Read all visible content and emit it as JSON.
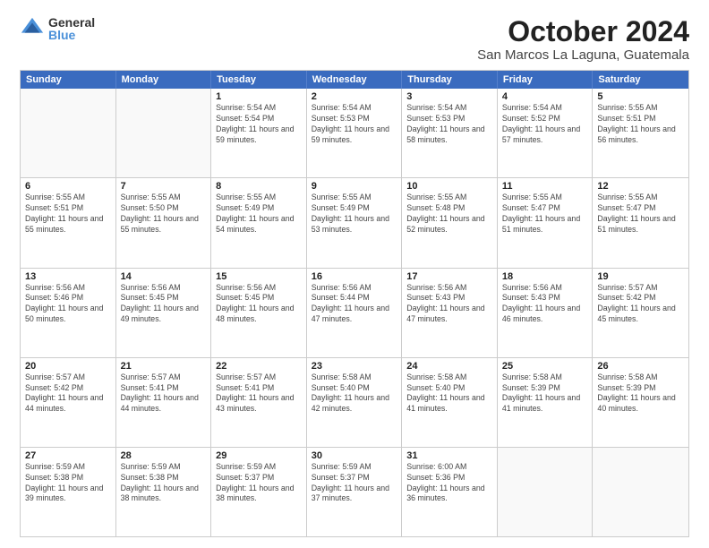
{
  "logo": {
    "general": "General",
    "blue": "Blue"
  },
  "title": "October 2024",
  "location": "San Marcos La Laguna, Guatemala",
  "header_days": [
    "Sunday",
    "Monday",
    "Tuesday",
    "Wednesday",
    "Thursday",
    "Friday",
    "Saturday"
  ],
  "weeks": [
    [
      {
        "day": "",
        "detail": ""
      },
      {
        "day": "",
        "detail": ""
      },
      {
        "day": "1",
        "detail": "Sunrise: 5:54 AM\nSunset: 5:54 PM\nDaylight: 11 hours and 59 minutes."
      },
      {
        "day": "2",
        "detail": "Sunrise: 5:54 AM\nSunset: 5:53 PM\nDaylight: 11 hours and 59 minutes."
      },
      {
        "day": "3",
        "detail": "Sunrise: 5:54 AM\nSunset: 5:53 PM\nDaylight: 11 hours and 58 minutes."
      },
      {
        "day": "4",
        "detail": "Sunrise: 5:54 AM\nSunset: 5:52 PM\nDaylight: 11 hours and 57 minutes."
      },
      {
        "day": "5",
        "detail": "Sunrise: 5:55 AM\nSunset: 5:51 PM\nDaylight: 11 hours and 56 minutes."
      }
    ],
    [
      {
        "day": "6",
        "detail": "Sunrise: 5:55 AM\nSunset: 5:51 PM\nDaylight: 11 hours and 55 minutes."
      },
      {
        "day": "7",
        "detail": "Sunrise: 5:55 AM\nSunset: 5:50 PM\nDaylight: 11 hours and 55 minutes."
      },
      {
        "day": "8",
        "detail": "Sunrise: 5:55 AM\nSunset: 5:49 PM\nDaylight: 11 hours and 54 minutes."
      },
      {
        "day": "9",
        "detail": "Sunrise: 5:55 AM\nSunset: 5:49 PM\nDaylight: 11 hours and 53 minutes."
      },
      {
        "day": "10",
        "detail": "Sunrise: 5:55 AM\nSunset: 5:48 PM\nDaylight: 11 hours and 52 minutes."
      },
      {
        "day": "11",
        "detail": "Sunrise: 5:55 AM\nSunset: 5:47 PM\nDaylight: 11 hours and 51 minutes."
      },
      {
        "day": "12",
        "detail": "Sunrise: 5:55 AM\nSunset: 5:47 PM\nDaylight: 11 hours and 51 minutes."
      }
    ],
    [
      {
        "day": "13",
        "detail": "Sunrise: 5:56 AM\nSunset: 5:46 PM\nDaylight: 11 hours and 50 minutes."
      },
      {
        "day": "14",
        "detail": "Sunrise: 5:56 AM\nSunset: 5:45 PM\nDaylight: 11 hours and 49 minutes."
      },
      {
        "day": "15",
        "detail": "Sunrise: 5:56 AM\nSunset: 5:45 PM\nDaylight: 11 hours and 48 minutes."
      },
      {
        "day": "16",
        "detail": "Sunrise: 5:56 AM\nSunset: 5:44 PM\nDaylight: 11 hours and 47 minutes."
      },
      {
        "day": "17",
        "detail": "Sunrise: 5:56 AM\nSunset: 5:43 PM\nDaylight: 11 hours and 47 minutes."
      },
      {
        "day": "18",
        "detail": "Sunrise: 5:56 AM\nSunset: 5:43 PM\nDaylight: 11 hours and 46 minutes."
      },
      {
        "day": "19",
        "detail": "Sunrise: 5:57 AM\nSunset: 5:42 PM\nDaylight: 11 hours and 45 minutes."
      }
    ],
    [
      {
        "day": "20",
        "detail": "Sunrise: 5:57 AM\nSunset: 5:42 PM\nDaylight: 11 hours and 44 minutes."
      },
      {
        "day": "21",
        "detail": "Sunrise: 5:57 AM\nSunset: 5:41 PM\nDaylight: 11 hours and 44 minutes."
      },
      {
        "day": "22",
        "detail": "Sunrise: 5:57 AM\nSunset: 5:41 PM\nDaylight: 11 hours and 43 minutes."
      },
      {
        "day": "23",
        "detail": "Sunrise: 5:58 AM\nSunset: 5:40 PM\nDaylight: 11 hours and 42 minutes."
      },
      {
        "day": "24",
        "detail": "Sunrise: 5:58 AM\nSunset: 5:40 PM\nDaylight: 11 hours and 41 minutes."
      },
      {
        "day": "25",
        "detail": "Sunrise: 5:58 AM\nSunset: 5:39 PM\nDaylight: 11 hours and 41 minutes."
      },
      {
        "day": "26",
        "detail": "Sunrise: 5:58 AM\nSunset: 5:39 PM\nDaylight: 11 hours and 40 minutes."
      }
    ],
    [
      {
        "day": "27",
        "detail": "Sunrise: 5:59 AM\nSunset: 5:38 PM\nDaylight: 11 hours and 39 minutes."
      },
      {
        "day": "28",
        "detail": "Sunrise: 5:59 AM\nSunset: 5:38 PM\nDaylight: 11 hours and 38 minutes."
      },
      {
        "day": "29",
        "detail": "Sunrise: 5:59 AM\nSunset: 5:37 PM\nDaylight: 11 hours and 38 minutes."
      },
      {
        "day": "30",
        "detail": "Sunrise: 5:59 AM\nSunset: 5:37 PM\nDaylight: 11 hours and 37 minutes."
      },
      {
        "day": "31",
        "detail": "Sunrise: 6:00 AM\nSunset: 5:36 PM\nDaylight: 11 hours and 36 minutes."
      },
      {
        "day": "",
        "detail": ""
      },
      {
        "day": "",
        "detail": ""
      }
    ]
  ]
}
